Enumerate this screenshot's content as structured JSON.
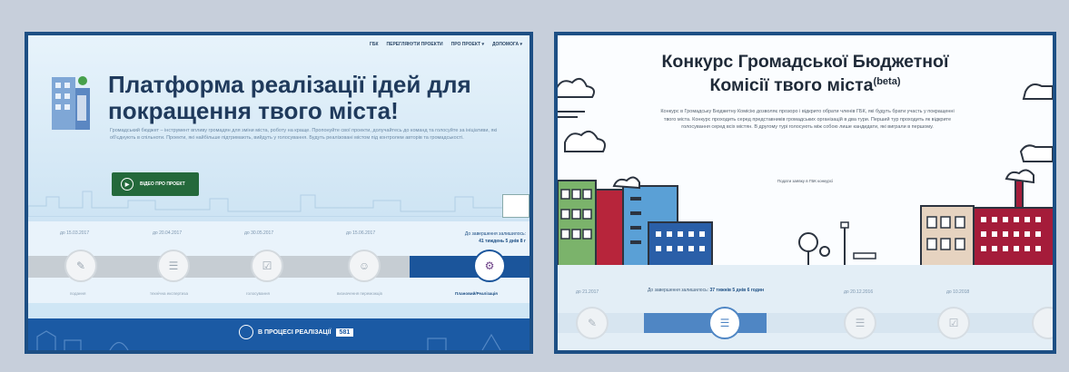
{
  "left_panel": {
    "nav": [
      "ГБК",
      "ПЕРЕГЛЯНУТИ ПРОЕКТИ",
      "ПРО ПРОЕКТ ▾",
      "ДОПОМОГА ▾"
    ],
    "title": "Платформа реалізації ідей для покращення твого міста!",
    "description": "Громадський бюджет – інструмент впливу громадян для зміни міста, роботу на краще. Пропонуйте свої проекти, долучайтесь до команд та голосуйте за ініціативи, які об'єднують в спільноти. Проекти, які найбільше підтримають, вийдуть у голосування. Будуть реалізовані містом під контролем авторів та громадськості.",
    "video_button": "ВІДЕО ПРО ПРОЕКТ",
    "stage_dates": [
      "до 15.03.2017",
      "до 20.04.2017",
      "до 30.05.2017",
      "до 15.06.2017"
    ],
    "countdown_label": "До завершення залишилось:",
    "countdown_value": "41 тиждень 5 днів 8 г",
    "stages": [
      "подання",
      "технічна експертиза",
      "голосування",
      "визначення переможців",
      "Плановий/Реалізація"
    ],
    "footer_label": "В ПРОЦЕСІ РЕАЛІЗАЦІЇ",
    "footer_count": "581"
  },
  "right_panel": {
    "title_line1": "Конкурс Громадської Бюджетної",
    "title_line2": "Комісії твого міста",
    "title_sup": "(beta)",
    "description": "Конкурс в Громадську Бюджетну Комісію дозволяє прозоро і відкрито обрати членів ГБК, які будуть брати участь у покращенні твого міста. Конкурс проходить серед представників громадських організацій в два тури. Перший тур проходить як відкрите голосування серед всіх містян. В другому турі голосують між собою лише кандидати, які виграли в першому.",
    "link_text": "Подати заявку в ГБК конкурсі",
    "stage_dates": [
      "до 21.2017",
      "до 20.12.2016",
      "до 10.2018"
    ],
    "countdown_label": "До завершення залишилось:",
    "countdown_value": "37 тижнів 5 днів 6 годин"
  },
  "colors": {
    "frame": "#1d4f84",
    "accent_green": "#24693b",
    "footer_blue": "#1b5aa4",
    "progress_blue": "#4f86c4"
  }
}
